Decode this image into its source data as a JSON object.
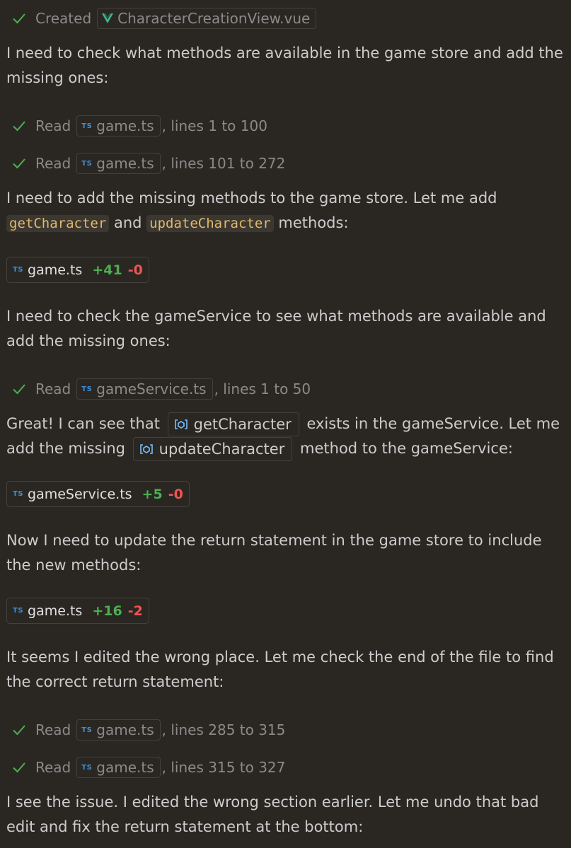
{
  "steps": {
    "created": {
      "verb": "Created",
      "file": "CharacterCreationView.vue"
    },
    "read1": {
      "verb": "Read",
      "file": "game.ts",
      "range": ", lines 1 to 100"
    },
    "read2": {
      "verb": "Read",
      "file": "game.ts",
      "range": ", lines 101 to 272"
    },
    "read3": {
      "verb": "Read",
      "file": "gameService.ts",
      "range": ", lines 1 to 50"
    },
    "read4": {
      "verb": "Read",
      "file": "game.ts",
      "range": ", lines 285 to 315"
    },
    "read5": {
      "verb": "Read",
      "file": "game.ts",
      "range": ", lines 315 to 327"
    }
  },
  "ts_badge": "TS",
  "messages": {
    "m1": "I need to check what methods are available in the game store and add the missing ones:",
    "m2_pre": "I need to add the missing methods to the game store. Let me add ",
    "m2_code1": "getCharacter",
    "m2_mid": " and ",
    "m2_code2": "updateCharacter",
    "m2_post": " methods:",
    "m3": "I need to check the gameService to see what methods are available and add the missing ones:",
    "m4_pre": "Great! I can see that ",
    "m4_sym1": "getCharacter",
    "m4_mid": " exists in the gameService. Let me add the missing ",
    "m4_sym2": "updateCharacter",
    "m4_post": " method to the gameService:",
    "m5": "Now I need to update the return statement in the game store to include the new methods:",
    "m6": "It seems I edited the wrong place. Let me check the end of the file to find the correct return statement:",
    "m7": "I see the issue. I edited the wrong section earlier. Let me undo that bad edit and fix the return statement at the bottom:"
  },
  "edits": [
    {
      "file": "game.ts",
      "added": "+41",
      "removed": "-0"
    },
    {
      "file": "gameService.ts",
      "added": "+5",
      "removed": "-0"
    },
    {
      "file": "game.ts",
      "added": "+16",
      "removed": "-2"
    }
  ],
  "colors": {
    "background": "#2a2723",
    "added": "#4caf50",
    "removed": "#f05454",
    "check": "#4caf50",
    "ts_badge": "#3b8fd6",
    "vue": "#41b883"
  },
  "icons": [
    "check-icon",
    "vue-file-icon",
    "ts-file-icon",
    "symbol-method-icon"
  ]
}
